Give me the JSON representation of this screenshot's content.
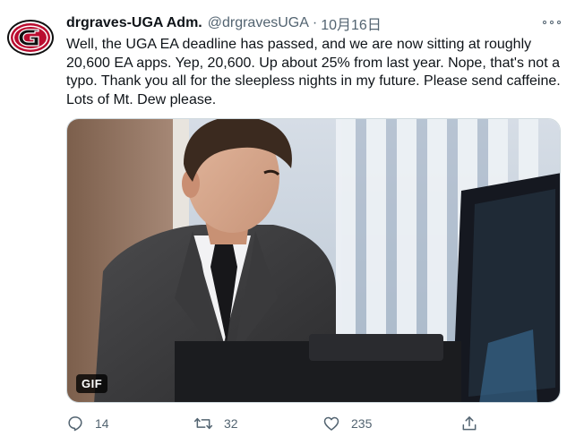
{
  "tweet": {
    "display_name": "drgraves-UGA Adm.",
    "handle": "@drgravesUGA",
    "separator": "·",
    "date": "10月16日",
    "text": "Well, the UGA EA deadline has passed, and we are now sitting at roughly 20,600 EA apps. Yep, 20,600. Up about 25% from last year. Nope, that's not a typo. Thank you all for the sleepless nights in my future. Please send caffeine. Lots of Mt. Dew please.",
    "media_badge": "GIF",
    "reply_count": "14",
    "retweet_count": "32",
    "like_count": "235"
  },
  "icons": {
    "avatar": "georgia-g-logo",
    "more": "more-options-icon",
    "reply": "reply-icon",
    "retweet": "retweet-icon",
    "like": "heart-icon",
    "share": "share-icon"
  },
  "colors": {
    "text_primary": "#0f1419",
    "text_secondary": "#536471",
    "brand_red": "#ba0c2f"
  }
}
